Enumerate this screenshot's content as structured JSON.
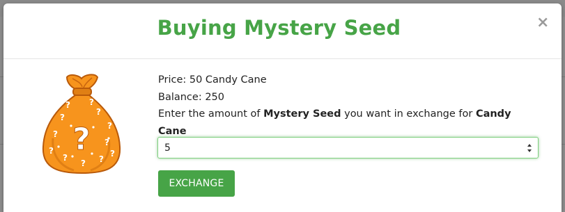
{
  "modal": {
    "title": "Buying Mystery Seed",
    "close_label": "×"
  },
  "item": {
    "icon": "mystery-bag-icon",
    "bag_color": "#f7941d"
  },
  "info": {
    "price_label": "Price: 50 Candy Cane",
    "balance_label": "Balance: 250",
    "prompt_prefix": "Enter the amount of ",
    "item_name": "Mystery Seed",
    "prompt_middle": " you want in exchange for ",
    "currency_name": "Candy Cane"
  },
  "amount_input": {
    "value": "5"
  },
  "actions": {
    "exchange_label": "EXCHANGE"
  },
  "colors": {
    "accent": "#47a447",
    "focus_border": "#7fcf7f"
  }
}
